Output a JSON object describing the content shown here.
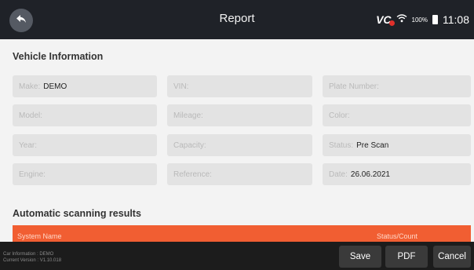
{
  "header": {
    "title": "Report",
    "vci_label": "VC",
    "battery_text": "100%",
    "time": "11:08",
    "back_icon": "back-arrow-icon"
  },
  "vehicle_info": {
    "title": "Vehicle Information",
    "fields": {
      "make": {
        "label": "Make:",
        "value": "DEMO"
      },
      "vin": {
        "label": "VIN:",
        "value": ""
      },
      "plate": {
        "label": "Plate Number:",
        "value": ""
      },
      "model": {
        "label": "Model:",
        "value": ""
      },
      "mileage": {
        "label": "Mileage:",
        "value": ""
      },
      "color": {
        "label": "Color:",
        "value": ""
      },
      "year": {
        "label": "Year:",
        "value": ""
      },
      "capacity": {
        "label": "Capacity:",
        "value": ""
      },
      "status": {
        "label": "Status:",
        "value": "Pre Scan"
      },
      "engine": {
        "label": "Engine:",
        "value": ""
      },
      "reference": {
        "label": "Reference:",
        "value": ""
      },
      "date": {
        "label": "Date:",
        "value": "26.06.2021"
      }
    }
  },
  "scan_results": {
    "title": "Automatic scanning results",
    "columns": [
      "System Name",
      "Status/Count"
    ]
  },
  "footer": {
    "info_line1": "Car Information : DEMO",
    "info_line2": "Current Version : V1.10.018",
    "buttons": {
      "save": "Save",
      "pdf": "PDF",
      "cancel": "Cancel"
    }
  },
  "colors": {
    "topbar": "#1f2228",
    "table_header": "#f15e32",
    "field_bg": "#e3e3e3",
    "footer": "#1c1c1c"
  }
}
